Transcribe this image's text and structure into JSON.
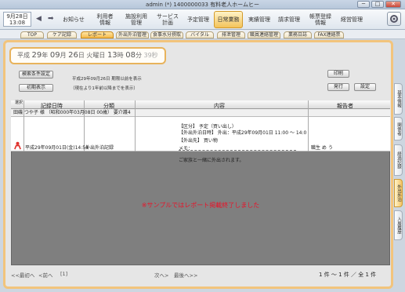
{
  "window": {
    "title": "admin (*) 1400000033 有料老人ホームヒー",
    "min": "─",
    "max": "□",
    "close": "✕"
  },
  "topnav": {
    "date_line1": "9月28日",
    "date_line2": "13:08",
    "items": [
      {
        "label": "お知らせ"
      },
      {
        "label": "利用者\n情報"
      },
      {
        "label": "施設利用\n管理"
      },
      {
        "label": "サービス\n計画"
      },
      {
        "label": "予定管理"
      },
      {
        "label": "日常業務"
      },
      {
        "label": "実績管理"
      },
      {
        "label": "請求管理"
      },
      {
        "label": "帳票登録\n情報"
      },
      {
        "label": "経営管理"
      }
    ]
  },
  "subtabs": [
    {
      "label": "TOP"
    },
    {
      "label": "ケア記録"
    },
    {
      "label": "レポート"
    },
    {
      "label": "外出外泊管理"
    },
    {
      "label": "食事水分摂取"
    },
    {
      "label": "バイタル"
    },
    {
      "label": "排泄管理"
    },
    {
      "label": "職員連絡管理"
    },
    {
      "label": "業務日誌"
    },
    {
      "label": "FAX連絡票"
    }
  ],
  "date_banner": {
    "era": "平成",
    "year": "29",
    "year_u": "年",
    "month": "09",
    "month_u": "月",
    "day": "26",
    "day_u": "日",
    "weekday": "火曜日",
    "hour": "13",
    "hour_u": "時",
    "minute": "08",
    "minute_u": "分",
    "second": "39秒"
  },
  "controls": {
    "search_settings": "検索条件設定",
    "initial_display": "初期表示",
    "print": "印刷",
    "issue": "発行",
    "config": "設定",
    "info_line1": "平成29年09月26日 期限以前を表示",
    "info_line2": "（現在より1年前以降までを表示）"
  },
  "table": {
    "headers": {
      "select": "選択",
      "datetime": "記録日時",
      "category": "分類",
      "content": "内容",
      "reporter": "報告者"
    },
    "group_label": "田磯 つや子 様 （昭和000年03月08日 00歳） 要介護4",
    "row": {
      "datetime": "平成29年09月01日(金)14:54",
      "category": "外出外泊記録",
      "content_l1": "【区分】 予定（買い出し）",
      "content_l2": "【外出外泊日時】 外出：平成29年09月01日 11:00 ～ 14:0",
      "content_l3": "【外出先】 買い物",
      "content_l4": "メモ：",
      "content_l5": "ご家族と一緒に外出されます。",
      "reporter": "職生 め う"
    },
    "message": "※サンプルではレポート掲載終了しました"
  },
  "footer": {
    "first": "<<最初へ",
    "prev": "<前へ",
    "page": "[1]",
    "next": "次へ>",
    "last": "最後へ>>",
    "count": "1 件 ～ 1 件 ／ 全 1 件"
  },
  "sidetabs": [
    {
      "label": "基本情報"
    },
    {
      "label": "関係者"
    },
    {
      "label": "経過記録"
    },
    {
      "label": "外出外泊"
    },
    {
      "label": "入居履歴"
    }
  ]
}
